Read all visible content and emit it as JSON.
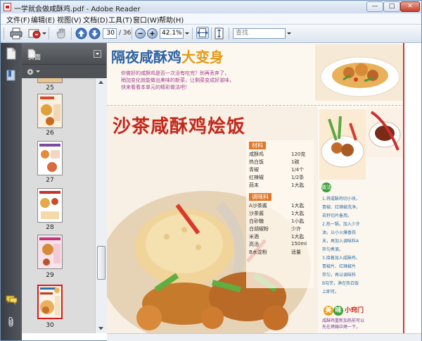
{
  "window": {
    "title": "一学就会做咸酥鸡.pdf - Adobe Reader",
    "min_label": "—",
    "max_label": "□",
    "close_label": "✕"
  },
  "menu": [
    "文件(F)",
    "编辑(E)",
    "视图(V)",
    "文档(D)",
    "工具(T)",
    "窗口(W)",
    "帮助(H)"
  ],
  "toolbar": {
    "current_page": "30",
    "page_total": "/ 36",
    "zoom": "42.1%",
    "search_placeholder": "查找"
  },
  "sidebar": {
    "panel_title": "页面",
    "thumbnails": [
      {
        "label": "25"
      },
      {
        "label": "26"
      },
      {
        "label": "27"
      },
      {
        "label": "28"
      },
      {
        "label": "29"
      },
      {
        "label": "30"
      }
    ]
  },
  "document": {
    "headline_part1": "隔夜咸酥鸡",
    "headline_part2": "大变身",
    "intro_line1": "你做好的咸酥鸡是否一次没有吃完？别再丢弃了，",
    "intro_line2": "稍加变化就能做出美味的新菜，让剩菜变成好滋味，",
    "intro_line3": "快来看看本单元的精彩做法吧！",
    "recipe_title": "沙茶咸酥鸡烩饭",
    "ingredients_header": "材料",
    "ingredients": [
      {
        "name": "咸酥鸡",
        "amount": "120克"
      },
      {
        "name": "热白饭",
        "amount": "1碗"
      },
      {
        "name": "青椒",
        "amount": "1/4个"
      },
      {
        "name": "红辣椒",
        "amount": "1/2条"
      },
      {
        "name": "蒜末",
        "amount": "1大匙"
      }
    ],
    "seasoning_header": "调味料",
    "seasonings": [
      {
        "name": "A沙茶酱",
        "amount": "1大匙"
      },
      {
        "name": "沙茶酱",
        "amount": "1大匙"
      },
      {
        "name": "白砂糖",
        "amount": "1小匙"
      },
      {
        "name": "白胡椒粉",
        "amount": "少许"
      },
      {
        "name": "米酒",
        "amount": "1大匙"
      },
      {
        "name": "高汤",
        "amount": "150ml"
      },
      {
        "name": "B水淀粉",
        "amount": "适量"
      }
    ],
    "method_header": "做法",
    "steps": [
      "1.将咸酥鸡切小块，",
      "  青椒、红辣椒洗净，",
      "  去籽切片备用。",
      "2.热一锅，加入少许",
      "  油，以小火爆香蒜",
      "  末，再加入调味料A",
      "  拌匀煮滚。",
      "3.接着加入咸酥鸡、",
      "  青椒片、红辣椒片",
      "  拌匀，再以调味料",
      "  B勾芡，淋在热白饭",
      "  上即可。"
    ],
    "tip_label_1": "美",
    "tip_label_2": "味",
    "tip_label_3": "小窍门",
    "tip_line1": "咸酥鸡重新加热前可以",
    "tip_line2": "先在烤箱中烤一下，"
  }
}
